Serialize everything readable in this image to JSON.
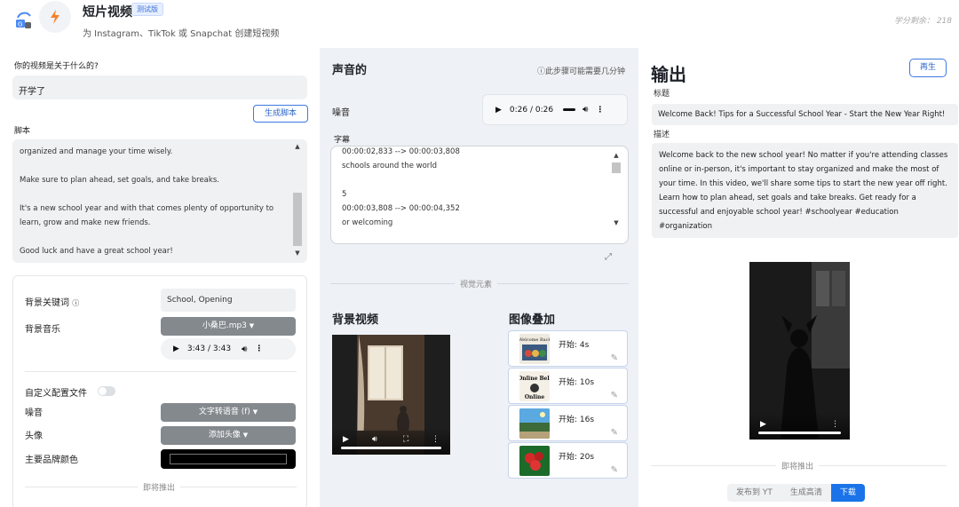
{
  "header": {
    "title": "短片视频",
    "badge": "测试版",
    "subtitle": "为 Instagram、TikTok 或 Snapchat 创建短视频",
    "credits": "学分剩余： 218"
  },
  "left": {
    "topic_label": "你的视频是关于什么的?",
    "topic_value": "开学了",
    "generate_script_button": "生成脚本",
    "script_label": "脚本",
    "script_paragraphs": [
      "organized and manage your time wisely.",
      "Make sure to plan ahead, set goals, and take breaks.",
      "It's a new school year and with that comes plenty of opportunity to learn, grow and make new friends.",
      "Good luck and have a great school year!"
    ],
    "bg_keyword_label": "背景关键词",
    "bg_keyword_value": "School, Opening",
    "bg_music_label": "背景音乐",
    "bg_music_select": "小桑巴.mp3",
    "music_time": "3:43 / 3:43",
    "custom_config_label": "自定义配置文件",
    "noise_label": "噪音",
    "noise_select": "文字转语音 (f)",
    "avatar_label": "头像",
    "avatar_select": "添加头像",
    "brand_color_label": "主要品牌颜色",
    "brand_color": "#000000",
    "coming_soon": "即将推出"
  },
  "middle": {
    "sound_title": "声音的",
    "time_note": "此步骤可能需要几分钟",
    "noise_label": "噪音",
    "noise_time": "0:26 / 0:26",
    "subtitle_label": "字幕",
    "subtitle_lines": [
      "00:00:02,833 --> 00:00:03,808",
      "schools around the world",
      "",
      "5",
      "00:00:03,808 --> 00:00:04,352",
      "or welcoming"
    ],
    "visual_elements": "视觉元素",
    "bg_video_title": "背景视频",
    "overlay_title": "图像叠加",
    "overlays": [
      {
        "start": "开始:  4s",
        "thumb_text": "Welcome Back to school",
        "thumb_color": "#3a5a80"
      },
      {
        "start": "开始:  10s",
        "thumb_text": "Online Bell Online",
        "thumb_color": "#f5f0e6"
      },
      {
        "start": "开始:  16s",
        "thumb_text": "",
        "thumb_color": "#2f7ab5"
      },
      {
        "start": "开始:  20s",
        "thumb_text": "",
        "thumb_color": "#1c6b2a"
      }
    ]
  },
  "right": {
    "output_title": "输出",
    "regen_button": "再生",
    "title_label": "标题",
    "title_value": "Welcome Back! Tips for a Successful School Year - Start the New Year Right!",
    "desc_label": "描述",
    "desc_value": "Welcome back to the new school year! No matter if you're attending classes online or in-person, it's important to stay organized and make the most of your time. In this video, we'll share some tips to start the new year off right. Learn how to plan ahead, set goals and take breaks. Get ready for a successful and enjoyable school year! #schoolyear #education #organization",
    "coming_soon": "即将推出",
    "tabs": [
      "发布到 YT",
      "生成高清",
      "下载"
    ]
  },
  "icons": [
    "app-logo-icon",
    "lightning-icon",
    "info-icon",
    "play-icon",
    "volume-icon",
    "more-icon",
    "fullscreen-icon",
    "expand-icon",
    "edit-icon",
    "chevron-down-icon"
  ],
  "colors": {
    "accent": "#1a73e8",
    "middle_bg": "#eef1f5",
    "dropdown": "#84898e"
  }
}
